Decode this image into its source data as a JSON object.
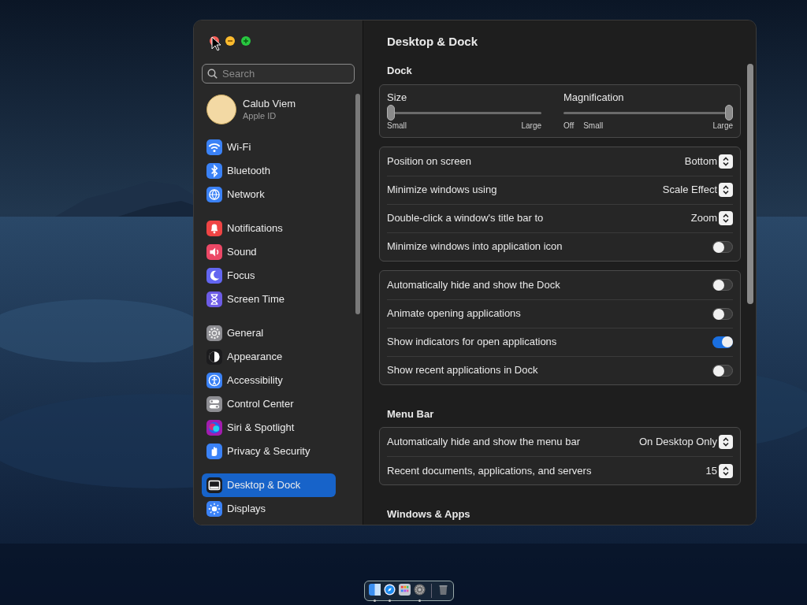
{
  "window": {
    "title": "Desktop & Dock"
  },
  "sidebar": {
    "search": {
      "placeholder": "Search"
    },
    "account": {
      "name": "Calub Viem",
      "subtitle": "Apple ID"
    },
    "groups": [
      [
        {
          "label": "Wi-Fi",
          "kind": "wifi",
          "color": "#3b82f6",
          "selected": false
        },
        {
          "label": "Bluetooth",
          "kind": "bluetooth",
          "color": "#3b82f6",
          "selected": false
        },
        {
          "label": "Network",
          "kind": "globe",
          "color": "#3b82f6",
          "selected": false
        }
      ],
      [
        {
          "label": "Notifications",
          "kind": "bell",
          "color": "#ef4444",
          "selected": false
        },
        {
          "label": "Sound",
          "kind": "speaker",
          "color": "#ec4866",
          "selected": false
        },
        {
          "label": "Focus",
          "kind": "moon",
          "color": "#6366f1",
          "selected": false
        },
        {
          "label": "Screen Time",
          "kind": "hourglass",
          "color": "#6d5ce6",
          "selected": false
        }
      ],
      [
        {
          "label": "General",
          "kind": "gear",
          "color": "#8e8e93",
          "selected": false
        },
        {
          "label": "Appearance",
          "kind": "contrast",
          "color": "#1c1c1e",
          "selected": false
        },
        {
          "label": "Accessibility",
          "kind": "person",
          "color": "#3b82f6",
          "selected": false
        },
        {
          "label": "Control Center",
          "kind": "switches",
          "color": "#8e8e93",
          "selected": false
        },
        {
          "label": "Siri & Spotlight",
          "kind": "orb",
          "color": "#a21caf",
          "selected": false
        },
        {
          "label": "Privacy & Security",
          "kind": "hand",
          "color": "#3b82f6",
          "selected": false
        }
      ],
      [
        {
          "label": "Desktop & Dock",
          "kind": "dock",
          "color": "#1c1c1e",
          "selected": true
        },
        {
          "label": "Displays",
          "kind": "sun",
          "color": "#3b82f6",
          "selected": false
        }
      ]
    ]
  },
  "sections": [
    {
      "heading": "Dock",
      "cards": [
        {
          "kind": "sliders",
          "sliders": [
            {
              "label": "Size",
              "level": 0,
              "marks": [
                "Small",
                "Large"
              ]
            },
            {
              "label": "Magnification",
              "level": 1,
              "marks": [
                "Off",
                "Small",
                "Large"
              ]
            }
          ]
        },
        {
          "kind": "rows",
          "rows": [
            {
              "kind": "popup",
              "label": "Position on screen",
              "value": "Bottom"
            },
            {
              "kind": "popup",
              "label": "Minimize windows using",
              "value": "Scale Effect"
            },
            {
              "kind": "popup",
              "label": "Double-click a window's title bar to",
              "value": "Zoom"
            },
            {
              "kind": "toggle",
              "label": "Minimize windows into application icon",
              "on": false
            }
          ]
        },
        {
          "kind": "rows",
          "rows": [
            {
              "kind": "toggle",
              "label": "Automatically hide and show the Dock",
              "on": false
            },
            {
              "kind": "toggle",
              "label": "Animate opening applications",
              "on": false
            },
            {
              "kind": "toggle",
              "label": "Show indicators for open applications",
              "on": true
            },
            {
              "kind": "toggle",
              "label": "Show recent applications in Dock",
              "on": false
            }
          ]
        }
      ]
    },
    {
      "heading": "Menu Bar",
      "cards": [
        {
          "kind": "rows",
          "rows": [
            {
              "kind": "popup",
              "label": "Automatically hide and show the menu bar",
              "value": "On Desktop Only"
            },
            {
              "kind": "popup",
              "label": "Recent documents, applications, and servers",
              "value": "15"
            }
          ]
        }
      ]
    },
    {
      "heading": "Windows & Apps"
    }
  ],
  "dock": {
    "items": [
      {
        "kind": "finder",
        "running": true
      },
      {
        "kind": "compass",
        "running": true
      },
      {
        "kind": "grid",
        "running": false
      },
      {
        "kind": "gear",
        "running": true
      },
      {
        "kind": "trash",
        "running": false
      }
    ]
  }
}
